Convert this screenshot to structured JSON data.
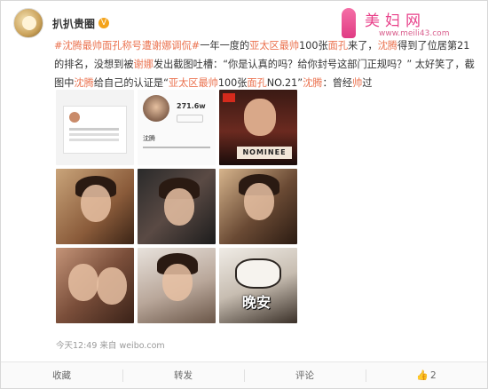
{
  "author": {
    "name": "扒扒贵圈",
    "verified_badge": "V"
  },
  "watermark": {
    "title": "美妇网",
    "url": "www.meili43.com"
  },
  "post": {
    "hashtag": "#沈腾最帅面孔称号遭谢娜调侃#",
    "t1": "一年一度的",
    "h1": "亚太区最帅",
    "t2": "100张",
    "h2": "面孔",
    "t3": "来了，",
    "h3": "沈腾",
    "t4": "得到了位居第21的排名，没想到被",
    "h4": "谢娜",
    "t5": "发出截图吐槽：“你是认真的吗？给你封号这部门正规吗？” 太好笑了，截图中",
    "h5": "沈腾",
    "t6": "给自己的认证是“",
    "h6": "亚太区最帅",
    "t7": "100张",
    "h7": "面孔",
    "t8": "NO.21”",
    "h8": "沈腾",
    "t9": "：曾经",
    "h9": "帅",
    "t10": "过"
  },
  "images": {
    "thumb2_num": "271.6w",
    "thumb2_name": "沈腾",
    "thumb3_badge": "NOMINEE",
    "thumb9_caption": "晚安"
  },
  "meta": {
    "time": "今天12:49",
    "source": "来自 weibo.com"
  },
  "actions": {
    "collect": "收藏",
    "repost": "转发",
    "comment": "评论",
    "like_icon": "thumbs-up-icon",
    "like_count": "2"
  }
}
